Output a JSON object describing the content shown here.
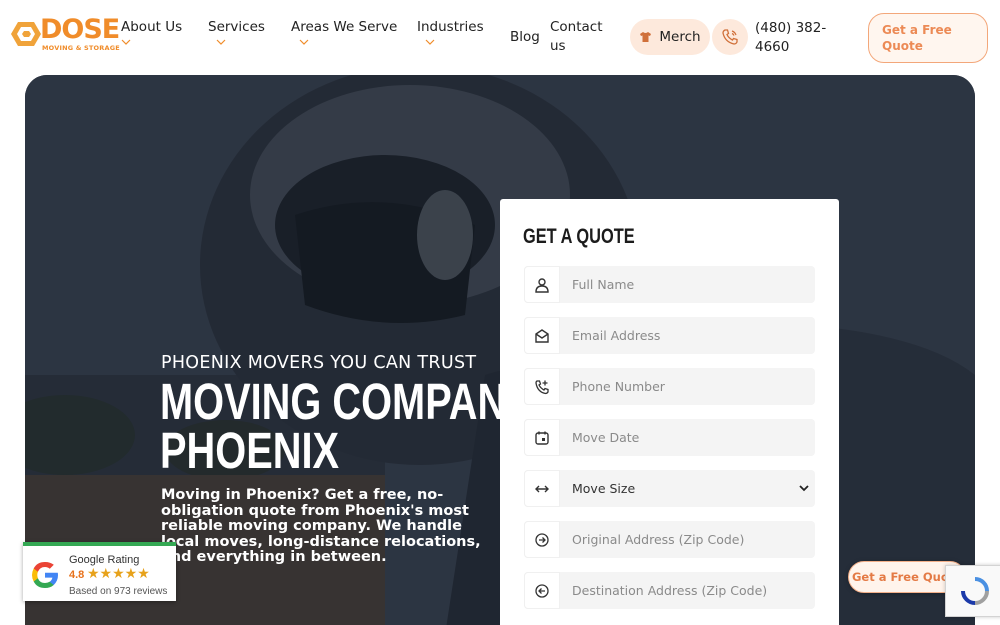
{
  "brand": {
    "logo_text": "DOSE",
    "logo_subtext": "MOVING & STORAGE",
    "color": "#f08c2a"
  },
  "nav": {
    "about": "About Us",
    "services": "Services",
    "areas": "Areas We Serve",
    "industries": "Industries",
    "blog": "Blog",
    "contact": "Contact us",
    "merch": "Merch",
    "phone": "(480) 382-4660",
    "cta": "Get a Free Quote"
  },
  "hero": {
    "kicker": "PHOENIX MOVERS YOU CAN TRUST",
    "title_line1": "MOVING COMPANY",
    "title_line2": "PHOENIX",
    "description": "Moving in Phoenix? Get a free, no-obligation quote from Phoenix's most reliable moving company. We handle local moves, long-distance relocations, and everything in between."
  },
  "quote_form": {
    "title": "GET A QUOTE",
    "full_name": "Full Name",
    "email": "Email Address",
    "phone": "Phone Number",
    "move_date": "Move Date",
    "move_size": "Move Size",
    "origin": "Original Address (Zip Code)",
    "destination": "Destination Address (Zip Code)"
  },
  "rating": {
    "label": "Google Rating",
    "score": "4.8",
    "stars": "★★★★★",
    "reviews": "Based on 973 reviews"
  },
  "floating_cta": "Get a Free Quote",
  "icons": {
    "logo": "dose-logo-icon",
    "chevron": "chevron-down-icon",
    "merch": "tshirt-icon",
    "phone": "phone-icon",
    "user": "user-icon",
    "email": "envelope-icon",
    "phone_field": "phone-plus-icon",
    "calendar": "calendar-icon",
    "size": "arrows-horizontal-icon",
    "address": "location-arrow-icon",
    "google": "google-g-icon",
    "recaptcha": "recaptcha-icon"
  },
  "colors": {
    "accent": "#f08c2a",
    "cta_bg": "#fde9dc",
    "cta_text": "#ec8a55",
    "google_green": "#34a853"
  }
}
